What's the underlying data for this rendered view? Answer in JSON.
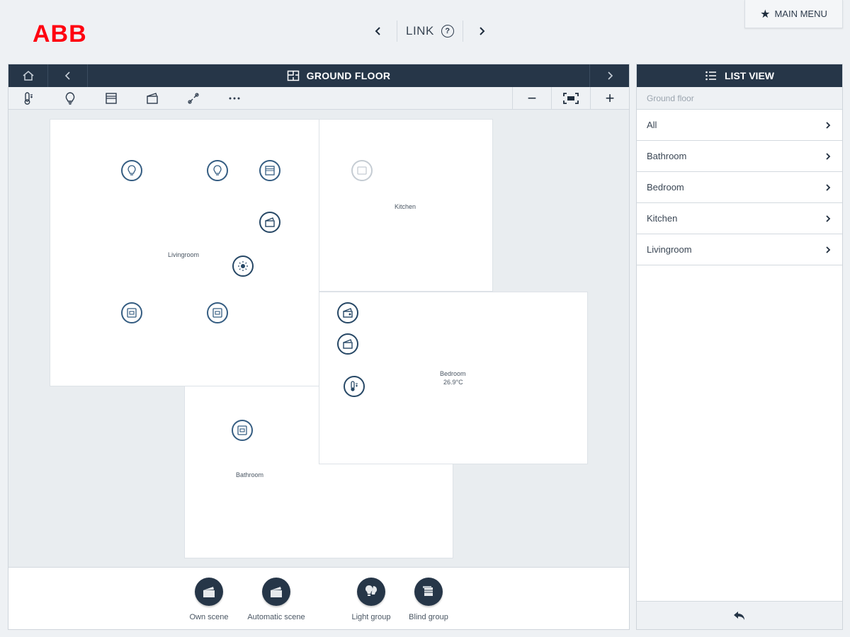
{
  "brand": {
    "logo_text": "ABB",
    "logo_color": "#ff000f"
  },
  "top_nav": {
    "title": "LINK",
    "prev_icon": "chevron-left-icon",
    "next_icon": "chevron-right-icon",
    "help_icon": "help-icon"
  },
  "main_menu": {
    "label": "MAIN MENU",
    "icon": "star-icon"
  },
  "floor": {
    "title": "GROUND FLOOR",
    "toolbar": [
      "thermostat-filter-icon",
      "light-filter-icon",
      "blind-filter-icon",
      "scene-filter-icon",
      "link-filter-icon",
      "more-icon"
    ],
    "zoom_out": "−",
    "zoom_in": "+",
    "rooms": {
      "livingroom": "Livingroom",
      "kitchen": "Kitchen",
      "bedroom": "Bedroom",
      "bedroom_temp": "26.9°C",
      "bathroom": "Bathroom"
    },
    "groups": [
      {
        "label": "Own scene",
        "icon": "scene-icon"
      },
      {
        "label": "Automatic scene",
        "icon": "scene-icon"
      },
      {
        "label": "Light group",
        "icon": "bulb-group-icon"
      },
      {
        "label": "Blind group",
        "icon": "blind-group-icon"
      }
    ]
  },
  "list_view": {
    "title": "LIST VIEW",
    "breadcrumb": "Ground floor",
    "items": [
      "All",
      "Bathroom",
      "Bedroom",
      "Kitchen",
      "Livingroom"
    ],
    "back_icon": "back-arrow-icon"
  },
  "colors": {
    "header_bg": "#263648",
    "device_ring": "#355d82",
    "accent_red": "#ff000f"
  }
}
